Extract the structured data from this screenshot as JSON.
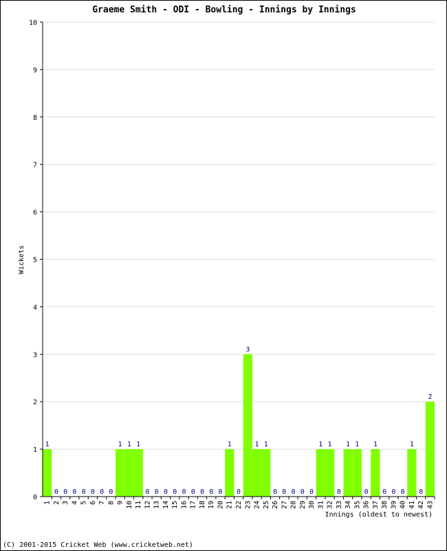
{
  "chart_data": {
    "type": "bar",
    "title": "Graeme Smith - ODI - Bowling - Innings by Innings",
    "xlabel": "Innings (oldest to newest)",
    "ylabel": "Wickets",
    "ylim": [
      0,
      10
    ],
    "yticks": [
      0,
      1,
      2,
      3,
      4,
      5,
      6,
      7,
      8,
      9,
      10
    ],
    "grid": true,
    "bar_color": "#80ff00",
    "label_color": "#000080",
    "categories": [
      "1",
      "2",
      "3",
      "4",
      "5",
      "6",
      "7",
      "8",
      "9",
      "10",
      "11",
      "12",
      "13",
      "14",
      "15",
      "16",
      "17",
      "18",
      "19",
      "20",
      "21",
      "22",
      "23",
      "24",
      "25",
      "26",
      "27",
      "28",
      "29",
      "30",
      "31",
      "32",
      "33",
      "34",
      "35",
      "36",
      "37",
      "38",
      "39",
      "40",
      "41",
      "42",
      "43"
    ],
    "values": [
      1,
      0,
      0,
      0,
      0,
      0,
      0,
      0,
      1,
      1,
      1,
      0,
      0,
      0,
      0,
      0,
      0,
      0,
      0,
      0,
      1,
      0,
      3,
      1,
      1,
      0,
      0,
      0,
      0,
      0,
      1,
      1,
      0,
      1,
      1,
      0,
      1,
      0,
      0,
      0,
      1,
      0,
      2
    ]
  },
  "footer": "(C) 2001-2015 Cricket Web (www.cricketweb.net)"
}
